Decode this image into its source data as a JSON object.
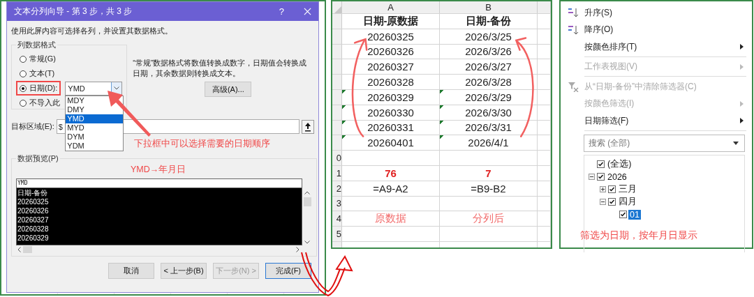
{
  "dialog": {
    "title": "文本分列向导 - 第 3 步，共 3 步",
    "help": "?",
    "instruction": "使用此屏内容可选择各列，并设置其数据格式。",
    "format_group": {
      "label": "列数据格式",
      "options": [
        {
          "label": "常规(G)",
          "selected": false
        },
        {
          "label": "文本(T)",
          "selected": false
        },
        {
          "label": "日期(D):",
          "selected": true
        },
        {
          "label": "不导入此",
          "selected": false
        }
      ]
    },
    "date_order": {
      "value": "YMD",
      "options": [
        {
          "label": "MDY",
          "selected": false
        },
        {
          "label": "DMY",
          "selected": false
        },
        {
          "label": "YMD",
          "selected": true
        },
        {
          "label": "MYD",
          "selected": false
        },
        {
          "label": "DYM",
          "selected": false
        },
        {
          "label": "YDM",
          "selected": false
        }
      ]
    },
    "description": "“常规”数据格式将数值转换成数字，日期值会转换成日期，其余数据则转换成文本。",
    "advanced_button": "高级(A)...",
    "destination": {
      "label": "目标区域(E):",
      "value": "$"
    },
    "dropdown_note": "下拉框中可以选择需要的日期顺序",
    "preview": {
      "label": "数据预览(P)",
      "note": "YMD→年月日",
      "header": "YMD",
      "rows": [
        "日期-备份",
        "20260325",
        "20260326",
        "20260327",
        "20260328",
        "20260329"
      ]
    },
    "buttons": [
      {
        "label": "取消",
        "disabled": false,
        "default": false
      },
      {
        "label": "< 上一步(B)",
        "disabled": false,
        "default": false
      },
      {
        "label": "下一步(N) >",
        "disabled": true,
        "default": false
      },
      {
        "label": "完成(F)",
        "disabled": false,
        "default": true
      }
    ]
  },
  "sheet": {
    "columns": [
      "A",
      "B"
    ],
    "rows": [
      {
        "kind": "header",
        "cells": [
          {
            "text": "日期-原数据"
          },
          {
            "text": "日期-备份"
          }
        ]
      },
      {
        "kind": "data",
        "cells": [
          {
            "text": "20260325",
            "flagged": false
          },
          {
            "text": "2026/3/25",
            "flagged": false
          }
        ]
      },
      {
        "kind": "data",
        "cells": [
          {
            "text": "20260326",
            "flagged": false
          },
          {
            "text": "2026/3/26",
            "flagged": false
          }
        ]
      },
      {
        "kind": "data",
        "cells": [
          {
            "text": "20260327",
            "flagged": false
          },
          {
            "text": "2026/3/27",
            "flagged": false
          }
        ]
      },
      {
        "kind": "data",
        "cells": [
          {
            "text": "20260328",
            "flagged": false
          },
          {
            "text": "2026/3/28",
            "flagged": false
          }
        ]
      },
      {
        "kind": "data",
        "cells": [
          {
            "text": "20260329",
            "flagged": true
          },
          {
            "text": "2026/3/29",
            "flagged": true
          }
        ]
      },
      {
        "kind": "data",
        "cells": [
          {
            "text": "20260330",
            "flagged": true
          },
          {
            "text": "2026/3/30",
            "flagged": true
          }
        ]
      },
      {
        "kind": "data",
        "cells": [
          {
            "text": "20260331",
            "flagged": true
          },
          {
            "text": "2026/3/31",
            "flagged": true
          }
        ]
      },
      {
        "kind": "data",
        "cells": [
          {
            "text": "20260401",
            "flagged": true
          },
          {
            "text": "2026/4/1",
            "flagged": true
          }
        ]
      },
      {
        "kind": "empty",
        "row_label": "0",
        "cells": []
      },
      {
        "kind": "total",
        "row_label": "1",
        "cells": [
          {
            "text": "76"
          },
          {
            "text": "7"
          }
        ]
      },
      {
        "kind": "formula",
        "row_label": "2",
        "cells": [
          {
            "text": "=A9-A2"
          },
          {
            "text": "=B9-B2"
          }
        ]
      },
      {
        "kind": "empty",
        "row_label": "3",
        "cells": []
      },
      {
        "kind": "note",
        "row_label": "4",
        "cells": [
          {
            "text": "原数据"
          },
          {
            "text": "分列后"
          }
        ]
      },
      {
        "kind": "empty",
        "row_label": "5",
        "cells": []
      }
    ]
  },
  "filter_menu": {
    "items": [
      {
        "kind": "sort-asc",
        "label": "升序(S)",
        "disabled": false,
        "submenu": false
      },
      {
        "kind": "sort-desc",
        "label": "降序(O)",
        "disabled": false,
        "submenu": false
      },
      {
        "kind": "plain",
        "label": "按颜色排序(T)",
        "disabled": false,
        "submenu": true
      },
      {
        "kind": "separator"
      },
      {
        "kind": "plain",
        "label": "工作表视图(V)",
        "disabled": true,
        "submenu": true
      },
      {
        "kind": "separator"
      },
      {
        "kind": "clear-filter",
        "label": "从“日期-备份”中清除筛选器(C)",
        "disabled": true,
        "submenu": false
      },
      {
        "kind": "plain",
        "label": "按颜色筛选(I)",
        "disabled": true,
        "submenu": true
      },
      {
        "kind": "plain",
        "label": "日期筛选(F)",
        "disabled": false,
        "submenu": true
      },
      {
        "kind": "separator"
      }
    ],
    "search": {
      "placeholder": "搜索 (全部)"
    },
    "tree": [
      {
        "label": "(全选)",
        "checked": true,
        "selected": false
      },
      {
        "label": "2026",
        "checked": true,
        "selected": false,
        "expanded": true,
        "children": [
          {
            "label": "三月",
            "checked": true,
            "selected": false,
            "expanded": false
          },
          {
            "label": "四月",
            "checked": true,
            "selected": false,
            "expanded": true,
            "children": [
              {
                "label": "01",
                "checked": true,
                "selected": true
              }
            ]
          }
        ]
      }
    ],
    "note": "筛选为日期，按年月日显示"
  }
}
